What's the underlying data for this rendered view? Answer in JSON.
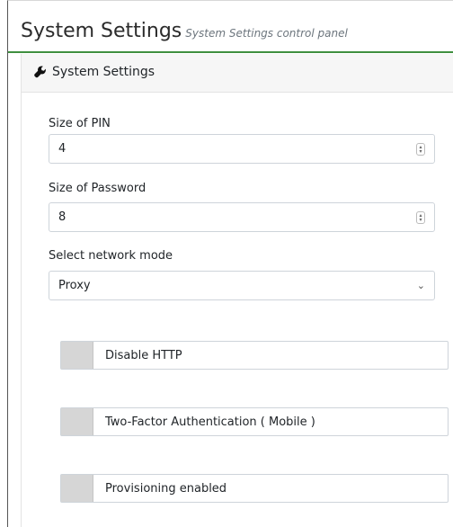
{
  "header": {
    "title": "System Settings",
    "subtitle": "System Settings control panel"
  },
  "card": {
    "title": "System Settings",
    "icon": "wrench-icon"
  },
  "form": {
    "pin": {
      "label": "Size of PIN",
      "value": "4"
    },
    "password": {
      "label": "Size of Password",
      "value": "8"
    },
    "network": {
      "label": "Select network mode",
      "value": "Proxy"
    }
  },
  "toggles": {
    "disable_http": "Disable HTTP",
    "two_factor": "Two-Factor Authentication ( Mobile )",
    "provisioning": "Provisioning enabled"
  },
  "colors": {
    "accent": "#3f8f3f",
    "toggle_off": "#d6d6d6"
  }
}
